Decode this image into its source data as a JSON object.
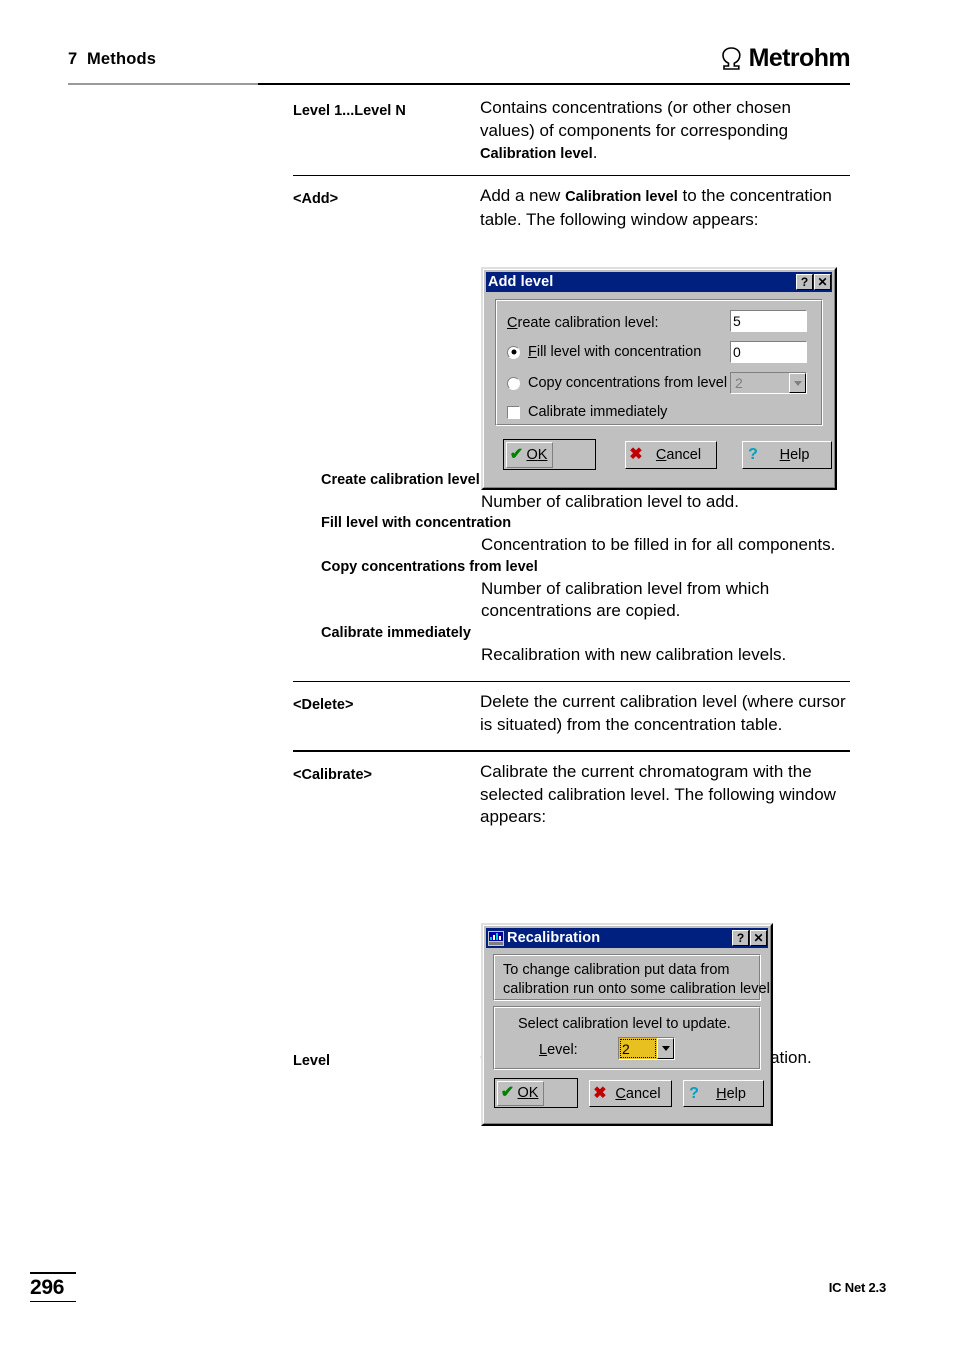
{
  "header": {
    "chapter": "7  Methods",
    "brand": "Metrohm",
    "brand_mark_icon": "omega-horseshoe-icon"
  },
  "content": {
    "entries": [
      {
        "term": "Level 1...Level N",
        "desc_parts": [
          {
            "t": "Contains concentrations (or other chosen values) of components for corresponding ",
            "b": false
          },
          {
            "t": "Calibration level",
            "b": true
          },
          {
            "t": ".",
            "b": false
          }
        ]
      },
      {
        "term": "<Add>",
        "desc_parts": [
          {
            "t": "Add a new ",
            "b": false
          },
          {
            "t": "Calibration level",
            "b": true
          },
          {
            "t": " to the concentration table. The following window appears:",
            "b": false
          }
        ]
      },
      {
        "term": "<Delete>",
        "desc_parts": [
          {
            "t": "Delete the current calibration level (where cursor is situated) from the concentration table.",
            "b": false
          }
        ]
      },
      {
        "term": "<Calibrate>",
        "desc_parts": [
          {
            "t": "Calibrate the current chromatogram with the selected calibration level. The following window appears:",
            "b": false
          }
        ]
      },
      {
        "term": "Level",
        "desc_parts": [
          {
            "t": "Calibration level to be used for recalibration.",
            "b": false
          }
        ]
      }
    ],
    "definitions": [
      {
        "term": "Create calibration level",
        "body": "Number of calibration level to add."
      },
      {
        "term": "Fill level with concentration",
        "body": "Concentration to be filled in for all components."
      },
      {
        "term": "Copy concentrations from level",
        "body": "Number of calibration level from which concentrations are copied."
      },
      {
        "term": "Calibrate immediately",
        "body": "Recalibration with new calibration levels."
      }
    ]
  },
  "dialog_add_level": {
    "title": "Add level",
    "titlebar_help_label": "?",
    "titlebar_close_label": "✕",
    "create_level_label_pre": "C",
    "create_level_label_post": "reate calibration level:",
    "create_level_value": "5",
    "fill_level_label_pre": "F",
    "fill_level_label_post": "ill level with concentration",
    "fill_level_value": "0",
    "fill_level_selected": true,
    "copy_level_label": "Copy concentrations from level",
    "copy_level_value": "2",
    "copy_level_selected": false,
    "copy_level_disabled": true,
    "calibrate_now_label": "Calibrate immediately",
    "calibrate_now_checked": false,
    "buttons": {
      "ok_pre": "O",
      "ok_post": "K",
      "ok_glyph": "✔",
      "ok_glyph_color": "#008000",
      "cancel_pre": "C",
      "cancel_post": "ancel",
      "cancel_glyph": "✖",
      "cancel_glyph_color": "#c00000",
      "help_pre": "H",
      "help_post": "elp",
      "help_glyph": "?",
      "help_glyph_color": "#00a0c0"
    }
  },
  "dialog_recalibration": {
    "title": "Recalibration",
    "titlebar_icon": "chart-app-icon",
    "titlebar_help_label": "?",
    "titlebar_close_label": "✕",
    "info_line1": "To change calibration put data from",
    "info_line2": "calibration run onto some calibration level.",
    "select_label": "Select calibration level to update.",
    "level_label_pre": "L",
    "level_label_post": "evel:",
    "level_value": "2",
    "level_value_bg": "#e8c020",
    "buttons": {
      "ok_pre": "O",
      "ok_post": "K",
      "ok_glyph": "✔",
      "ok_glyph_color": "#008000",
      "cancel_pre": "C",
      "cancel_post": "ancel",
      "cancel_glyph": "✖",
      "cancel_glyph_color": "#c00000",
      "help_pre": "H",
      "help_post": "elp",
      "help_glyph": "?",
      "help_glyph_color": "#00a0c0"
    }
  },
  "footer": {
    "page_number": "296",
    "doc_version": "IC Net 2.3"
  }
}
